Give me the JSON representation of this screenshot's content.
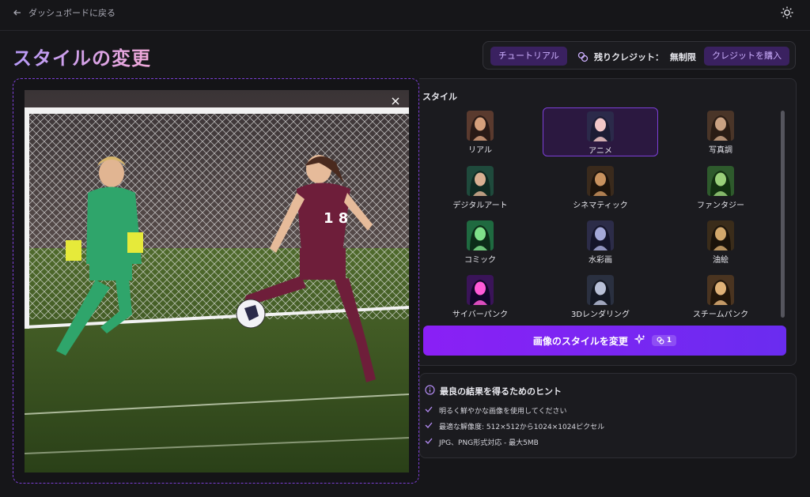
{
  "header": {
    "back_label": "ダッシュボードに戻る",
    "theme_icon": "sun-icon"
  },
  "page": {
    "title": "スタイルの変更"
  },
  "credits": {
    "tutorial_label": "チュートリアル",
    "remaining_label": "残りクレジット：",
    "remaining_value": "無制限",
    "buy_label": "クレジットを購入"
  },
  "styles": {
    "section_label": "スタイル",
    "selected": "アニメ",
    "items": [
      {
        "label": "リアル",
        "colors": [
          "#5a3a2e",
          "#d7a07c",
          "#2a1a16"
        ]
      },
      {
        "label": "アニメ",
        "colors": [
          "#2b2a4a",
          "#f2c7c8",
          "#1c1c34"
        ]
      },
      {
        "label": "写真調",
        "colors": [
          "#4a3528",
          "#caa283",
          "#2a1c14"
        ]
      },
      {
        "label": "デジタルアート",
        "colors": [
          "#1f4a3c",
          "#d8b092",
          "#0f2a22"
        ]
      },
      {
        "label": "シネマティック",
        "colors": [
          "#3a2a1c",
          "#c9925e",
          "#1e140c"
        ]
      },
      {
        "label": "ファンタジー",
        "colors": [
          "#2e5a2c",
          "#9ad07a",
          "#123010"
        ]
      },
      {
        "label": "コミック",
        "colors": [
          "#1f6a40",
          "#7fe08a",
          "#0c2c18"
        ]
      },
      {
        "label": "水彩画",
        "colors": [
          "#2c2c48",
          "#a4a8d8",
          "#14142a"
        ]
      },
      {
        "label": "油絵",
        "colors": [
          "#3a2c1a",
          "#d2a86c",
          "#1a130a"
        ]
      },
      {
        "label": "サイバーパンク",
        "colors": [
          "#3a1458",
          "#ff5ad8",
          "#12062a"
        ]
      },
      {
        "label": "3Dレンダリング",
        "colors": [
          "#2a3040",
          "#b8c0d8",
          "#141824"
        ]
      },
      {
        "label": "スチームパンク",
        "colors": [
          "#4a3420",
          "#e0b278",
          "#22160a"
        ]
      }
    ]
  },
  "apply": {
    "label": "画像のスタイルを変更",
    "cost": "1"
  },
  "tips": {
    "heading": "最良の結果を得るためのヒント",
    "items": [
      "明るく鮮やかな画像を使用してください",
      "最適な解像度: 512×512から1024×1024ピクセル",
      "JPG、PNG形式対応 - 最大5MB"
    ]
  },
  "colors": {
    "accent": "#7c3fd6",
    "button": "#8a20f5",
    "background": "#161619",
    "panel": "#1b1b1f"
  }
}
